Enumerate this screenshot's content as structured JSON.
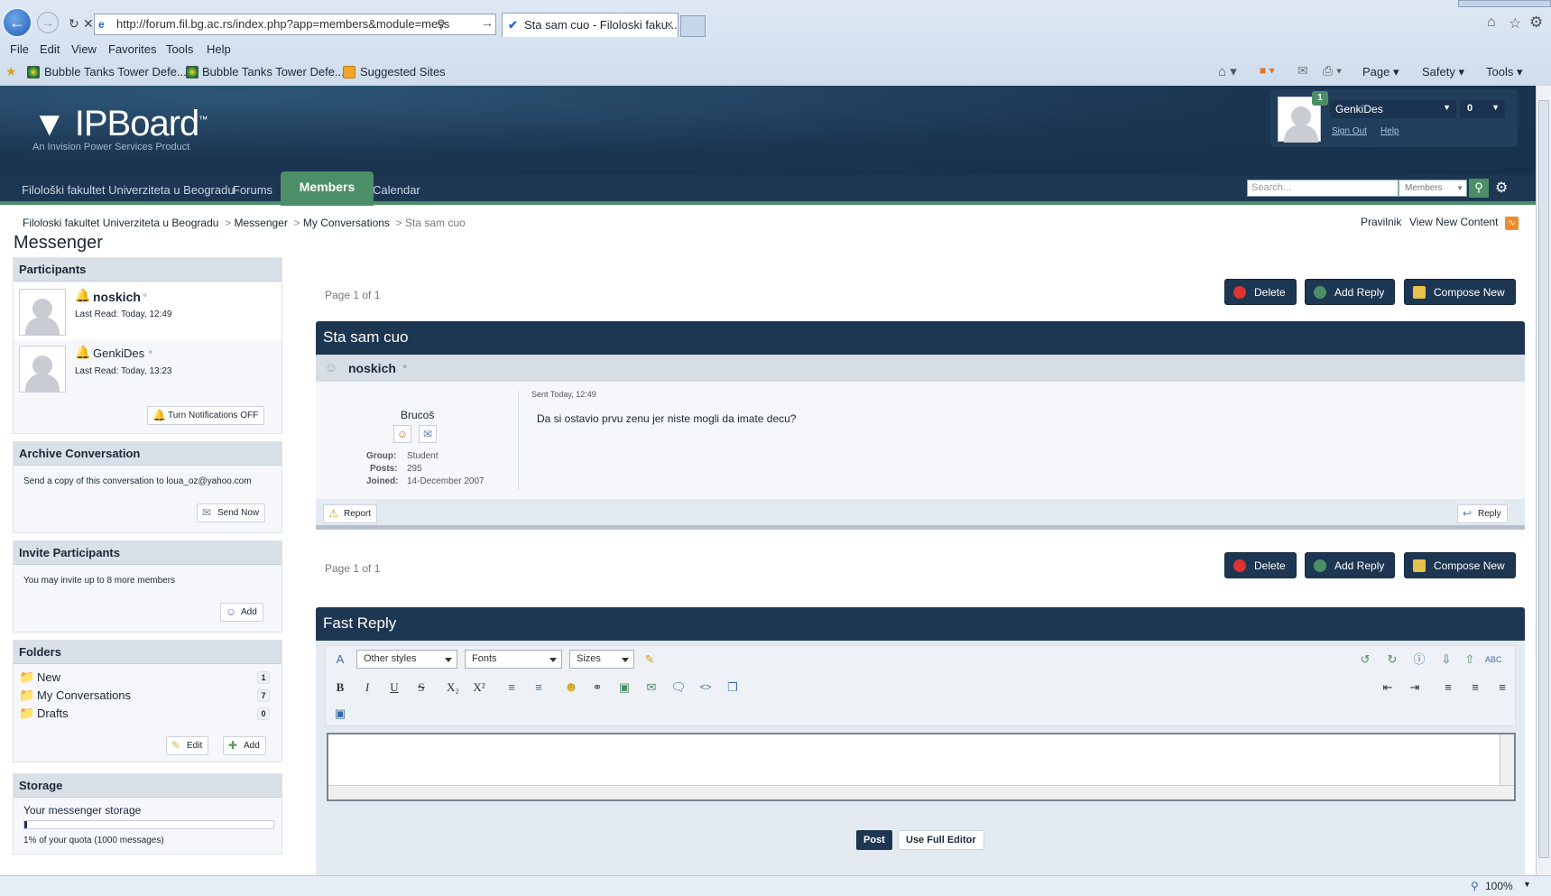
{
  "browser": {
    "url": "http://forum.fil.bg.ac.rs/index.php?app=members&module=mess",
    "tab_title": "Sta sam cuo - Filoloski faku...",
    "menu": [
      "File",
      "Edit",
      "View",
      "Favorites",
      "Tools",
      "Help"
    ],
    "favorites": [
      "Bubble Tanks Tower Defe...",
      "Bubble Tanks Tower Defe...",
      "Suggested Sites"
    ],
    "commandbar": [
      "Page",
      "Safety",
      "Tools"
    ],
    "zoom": "100%"
  },
  "header": {
    "logo": "IPBoard",
    "logo_tm": "™",
    "logo_sub": "An Invision Power Services Product",
    "user": {
      "name": "GenkiDes",
      "notify_count": "1",
      "msg_count": "0",
      "sign_out": "Sign Out",
      "help": "Help"
    }
  },
  "nav": {
    "items": [
      "Filološki fakultet Univerziteta u Beogradu",
      "Forums",
      "Members",
      "Calendar"
    ],
    "search_placeholder": "Search...",
    "search_scope": "Members"
  },
  "breadcrumb": {
    "items": [
      "Filoloski fakultet Univerziteta u Beogradu",
      "Messenger",
      "My Conversations",
      "Sta sam cuo"
    ],
    "right_links": [
      "Pravilnik",
      "View New Content"
    ]
  },
  "page_title": "Messenger",
  "sidebar": {
    "participants": {
      "title": "Participants",
      "people": [
        {
          "name": "noskich",
          "last_read": "Last Read: Today, 12:49"
        },
        {
          "name": "GenkiDes",
          "last_read": "Last Read: Today, 13:23"
        }
      ],
      "notify_button": "Turn Notifications OFF"
    },
    "archive": {
      "title": "Archive Conversation",
      "text": "Send a copy of this conversation to loua_oz@yahoo.com",
      "button": "Send Now"
    },
    "invite": {
      "title": "Invite Participants",
      "text": "You may invite up to 8 more members",
      "button": "Add"
    },
    "folders": {
      "title": "Folders",
      "items": [
        {
          "name": "New",
          "count": "1"
        },
        {
          "name": "My Conversations",
          "count": "7"
        },
        {
          "name": "Drafts",
          "count": "0"
        }
      ],
      "edit": "Edit",
      "add": "Add"
    },
    "storage": {
      "title": "Storage",
      "label": "Your messenger storage",
      "usage_fraction": 0.01,
      "text": "1% of your quota (1000 messages)"
    }
  },
  "main": {
    "pagination": "Page 1 of 1",
    "actions": {
      "delete": "Delete",
      "add_reply": "Add Reply",
      "compose": "Compose New"
    },
    "conversation_title": "Sta sam cuo",
    "post": {
      "author": "noskich",
      "rank": "Brucoš",
      "group_label": "Group:",
      "group": "Student",
      "posts_label": "Posts:",
      "posts": "295",
      "joined_label": "Joined:",
      "joined": "14-December 2007",
      "sent": "Sent Today, 12:49",
      "body": "Da si ostavio prvu zenu jer niste mogli da imate decu?",
      "report": "Report",
      "reply": "Reply"
    },
    "fast_reply": {
      "title": "Fast Reply",
      "styles": "Other styles",
      "fonts": "Fonts",
      "sizes": "Sizes",
      "post_button": "Post",
      "full_editor_button": "Use Full Editor"
    }
  },
  "colors": {
    "header_dark": "#1d3652",
    "accent_green": "#4c8e67",
    "link": "#1c2837"
  }
}
